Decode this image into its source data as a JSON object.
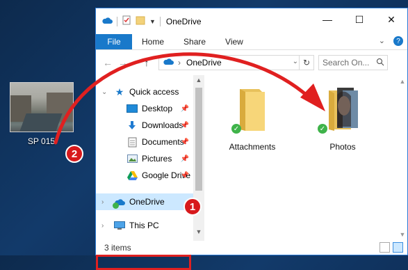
{
  "desktop": {
    "icon_label": "SP 015"
  },
  "window": {
    "title": "OneDrive",
    "ribbon": {
      "file": "File",
      "tabs": [
        "Home",
        "Share",
        "View"
      ],
      "help": "?"
    },
    "address": {
      "text": "OneDrive"
    },
    "search": {
      "placeholder": "Search On..."
    },
    "sidebar": {
      "items": [
        {
          "label": "Quick access",
          "icon": "star-icon"
        },
        {
          "label": "Desktop",
          "icon": "desktop-icon"
        },
        {
          "label": "Downloads",
          "icon": "downloads-icon"
        },
        {
          "label": "Documents",
          "icon": "documents-icon"
        },
        {
          "label": "Pictures",
          "icon": "pictures-icon"
        },
        {
          "label": "Google Drive",
          "icon": "google-drive-icon"
        },
        {
          "label": "OneDrive",
          "icon": "onedrive-icon"
        },
        {
          "label": "This PC",
          "icon": "pc-icon"
        }
      ]
    },
    "folders": [
      {
        "label": "Attachments"
      },
      {
        "label": "Photos"
      }
    ],
    "status": "3 items"
  },
  "annotations": {
    "badge1": "1",
    "badge2": "2"
  },
  "colors": {
    "accent": "#1979ca",
    "highlight": "#e02020",
    "sync": "#3fb34a"
  }
}
